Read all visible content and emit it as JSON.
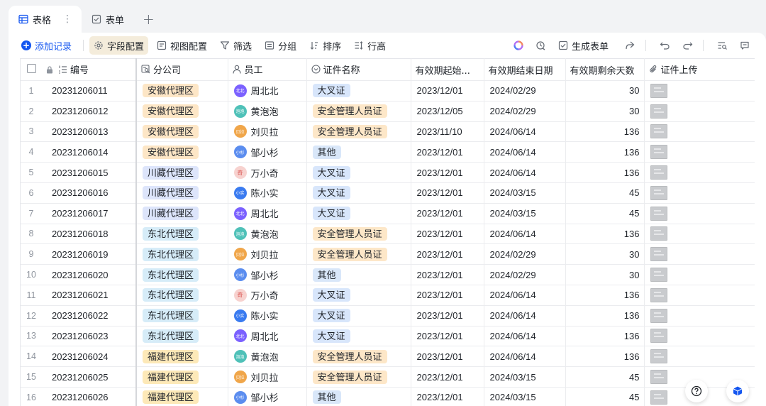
{
  "tabs": [
    {
      "label": "表格",
      "icon": "grid-table-icon",
      "active": true
    },
    {
      "label": "表单",
      "icon": "form-check-icon",
      "active": false
    }
  ],
  "toolbar": {
    "add_record": "添加记录",
    "field_config": "字段配置",
    "view_config": "视图配置",
    "filter": "筛选",
    "group": "分组",
    "sort": "排序",
    "row_height": "行高",
    "generate_form": "生成表单"
  },
  "columns": {
    "id": "编号",
    "branch": "分公司",
    "employee": "员工",
    "cert_name": "证件名称",
    "valid_start": "有效期起始...",
    "valid_end": "有效期结束日期",
    "days_left": "有效期剩余天数",
    "upload": "证件上传"
  },
  "colors": {
    "accent": "#1456f0",
    "tag_anhui": "#fde6c6",
    "tag_chuanzang": "#dde5fb",
    "tag_dongbei": "#d6ecf8",
    "tag_fujian": "#fde9b8",
    "tag_dacha": "#d8e6fb",
    "tag_safety": "#fde7c8",
    "tag_other": "#d9e7f9"
  },
  "rows": [
    {
      "idx": "1",
      "id": "20231206011",
      "branch": "安徽代理区",
      "branch_color": "#fde6c6",
      "user": "周北北",
      "avatar": "北北",
      "avatar_color": "#7b61ff",
      "cert": "大叉证",
      "cert_color": "#d8e6fb",
      "start": "2023/12/01",
      "end": "2024/02/29",
      "days": "30"
    },
    {
      "idx": "2",
      "id": "20231206012",
      "branch": "安徽代理区",
      "branch_color": "#fde6c6",
      "user": "黄泡泡",
      "avatar": "泡泡",
      "avatar_color": "#4fc1b8",
      "cert": "安全管理人员证",
      "cert_color": "#fde7c8",
      "start": "2023/12/05",
      "end": "2024/02/29",
      "days": "30"
    },
    {
      "idx": "3",
      "id": "20231206013",
      "branch": "安徽代理区",
      "branch_color": "#fde6c6",
      "user": "刘贝拉",
      "avatar": "贝拉",
      "avatar_color": "#f0a64a",
      "cert": "安全管理人员证",
      "cert_color": "#fde7c8",
      "start": "2023/11/10",
      "end": "2024/06/14",
      "days": "136"
    },
    {
      "idx": "4",
      "id": "20231206014",
      "branch": "安徽代理区",
      "branch_color": "#fde6c6",
      "user": "邹小杉",
      "avatar": "小杉",
      "avatar_color": "#5b8def",
      "cert": "其他",
      "cert_color": "#d9e7f9",
      "start": "2023/12/01",
      "end": "2024/06/14",
      "days": "136"
    },
    {
      "idx": "5",
      "id": "20231206015",
      "branch": "川藏代理区",
      "branch_color": "#dde5fb",
      "user": "万小奇",
      "avatar": "奇",
      "avatar_color": "#f7d2cf",
      "cert": "大叉证",
      "cert_color": "#d8e6fb",
      "start": "2023/12/01",
      "end": "2024/06/14",
      "days": "136"
    },
    {
      "idx": "6",
      "id": "20231206016",
      "branch": "川藏代理区",
      "branch_color": "#dde5fb",
      "user": "陈小实",
      "avatar": "小实",
      "avatar_color": "#3a7bf0",
      "cert": "大叉证",
      "cert_color": "#d8e6fb",
      "start": "2023/12/01",
      "end": "2024/03/15",
      "days": "45"
    },
    {
      "idx": "7",
      "id": "20231206017",
      "branch": "川藏代理区",
      "branch_color": "#dde5fb",
      "user": "周北北",
      "avatar": "北北",
      "avatar_color": "#7b61ff",
      "cert": "大叉证",
      "cert_color": "#d8e6fb",
      "start": "2023/12/01",
      "end": "2024/03/15",
      "days": "45"
    },
    {
      "idx": "8",
      "id": "20231206018",
      "branch": "东北代理区",
      "branch_color": "#d6ecf8",
      "user": "黄泡泡",
      "avatar": "泡泡",
      "avatar_color": "#4fc1b8",
      "cert": "安全管理人员证",
      "cert_color": "#fde7c8",
      "start": "2023/12/01",
      "end": "2024/06/14",
      "days": "136"
    },
    {
      "idx": "9",
      "id": "20231206019",
      "branch": "东北代理区",
      "branch_color": "#d6ecf8",
      "user": "刘贝拉",
      "avatar": "贝拉",
      "avatar_color": "#f0a64a",
      "cert": "安全管理人员证",
      "cert_color": "#fde7c8",
      "start": "2023/12/01",
      "end": "2024/02/29",
      "days": "30"
    },
    {
      "idx": "10",
      "id": "20231206020",
      "branch": "东北代理区",
      "branch_color": "#d6ecf8",
      "user": "邹小杉",
      "avatar": "小杉",
      "avatar_color": "#5b8def",
      "cert": "其他",
      "cert_color": "#d9e7f9",
      "start": "2023/12/01",
      "end": "2024/02/29",
      "days": "30"
    },
    {
      "idx": "11",
      "id": "20231206021",
      "branch": "东北代理区",
      "branch_color": "#d6ecf8",
      "user": "万小奇",
      "avatar": "奇",
      "avatar_color": "#f7d2cf",
      "cert": "大叉证",
      "cert_color": "#d8e6fb",
      "start": "2023/12/01",
      "end": "2024/06/14",
      "days": "136"
    },
    {
      "idx": "12",
      "id": "20231206022",
      "branch": "东北代理区",
      "branch_color": "#d6ecf8",
      "user": "陈小实",
      "avatar": "小实",
      "avatar_color": "#3a7bf0",
      "cert": "大叉证",
      "cert_color": "#d8e6fb",
      "start": "2023/12/01",
      "end": "2024/06/14",
      "days": "136"
    },
    {
      "idx": "13",
      "id": "20231206023",
      "branch": "东北代理区",
      "branch_color": "#d6ecf8",
      "user": "周北北",
      "avatar": "北北",
      "avatar_color": "#7b61ff",
      "cert": "大叉证",
      "cert_color": "#d8e6fb",
      "start": "2023/12/01",
      "end": "2024/06/14",
      "days": "136"
    },
    {
      "idx": "14",
      "id": "20231206024",
      "branch": "福建代理区",
      "branch_color": "#fde9b8",
      "user": "黄泡泡",
      "avatar": "泡泡",
      "avatar_color": "#4fc1b8",
      "cert": "安全管理人员证",
      "cert_color": "#fde7c8",
      "start": "2023/12/01",
      "end": "2024/06/14",
      "days": "136"
    },
    {
      "idx": "15",
      "id": "20231206025",
      "branch": "福建代理区",
      "branch_color": "#fde9b8",
      "user": "刘贝拉",
      "avatar": "贝拉",
      "avatar_color": "#f0a64a",
      "cert": "安全管理人员证",
      "cert_color": "#fde7c8",
      "start": "2023/12/01",
      "end": "2024/03/15",
      "days": "45"
    },
    {
      "idx": "16",
      "id": "20231206026",
      "branch": "福建代理区",
      "branch_color": "#fde9b8",
      "user": "邹小杉",
      "avatar": "小杉",
      "avatar_color": "#5b8def",
      "cert": "其他",
      "cert_color": "#d9e7f9",
      "start": "2023/12/01",
      "end": "2024/03/15",
      "days": "45"
    }
  ]
}
